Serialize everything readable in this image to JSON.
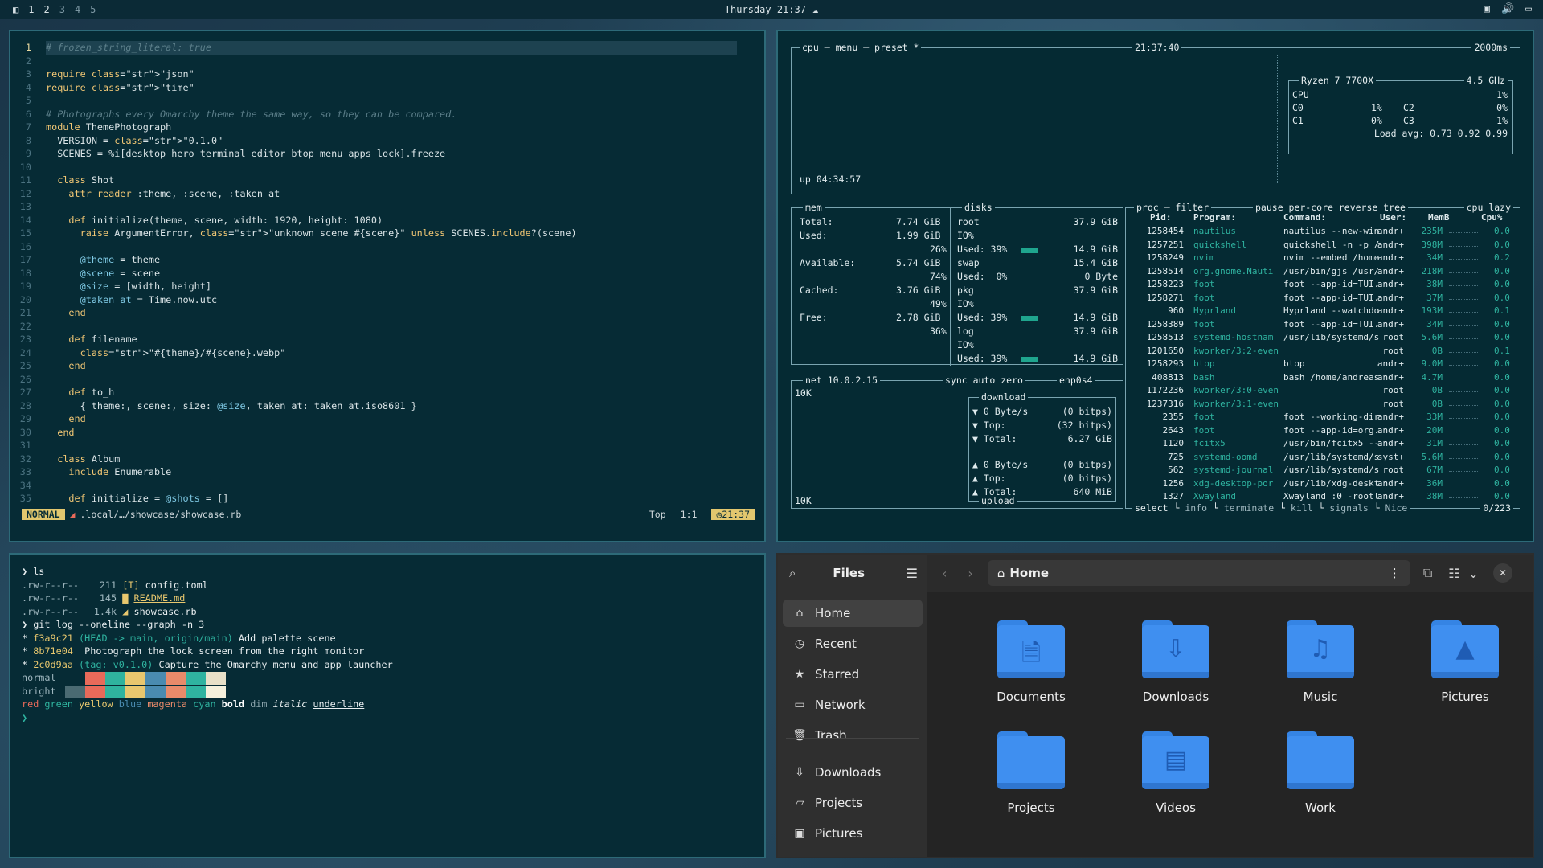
{
  "topbar": {
    "workspaces": [
      "1",
      "2",
      "3",
      "4",
      "5"
    ],
    "active": "1",
    "clock": "Thursday 21:37"
  },
  "nvim": {
    "lines": [
      {
        "n": "1",
        "t": "# frozen_string_literal: true"
      },
      {
        "n": "2",
        "t": ""
      },
      {
        "n": "3",
        "t": "require \"json\""
      },
      {
        "n": "4",
        "t": "require \"time\""
      },
      {
        "n": "5",
        "t": ""
      },
      {
        "n": "6",
        "t": "# Photographs every Omarchy theme the same way, so they can be compared."
      },
      {
        "n": "7",
        "t": "module ThemePhotograph"
      },
      {
        "n": "8",
        "t": "  VERSION = \"0.1.0\""
      },
      {
        "n": "9",
        "t": "  SCENES = %i[desktop hero terminal editor btop menu apps lock].freeze"
      },
      {
        "n": "10",
        "t": ""
      },
      {
        "n": "11",
        "t": "  class Shot"
      },
      {
        "n": "12",
        "t": "    attr_reader :theme, :scene, :taken_at"
      },
      {
        "n": "13",
        "t": ""
      },
      {
        "n": "14",
        "t": "    def initialize(theme, scene, width: 1920, height: 1080)"
      },
      {
        "n": "15",
        "t": "      raise ArgumentError, \"unknown scene #{scene}\" unless SCENES.include?(scene)"
      },
      {
        "n": "16",
        "t": ""
      },
      {
        "n": "17",
        "t": "      @theme = theme"
      },
      {
        "n": "18",
        "t": "      @scene = scene"
      },
      {
        "n": "19",
        "t": "      @size = [width, height]"
      },
      {
        "n": "20",
        "t": "      @taken_at = Time.now.utc"
      },
      {
        "n": "21",
        "t": "    end"
      },
      {
        "n": "22",
        "t": ""
      },
      {
        "n": "23",
        "t": "    def filename"
      },
      {
        "n": "24",
        "t": "      \"#{theme}/#{scene}.webp\""
      },
      {
        "n": "25",
        "t": "    end"
      },
      {
        "n": "26",
        "t": ""
      },
      {
        "n": "27",
        "t": "    def to_h"
      },
      {
        "n": "28",
        "t": "      { theme:, scene:, size: @size, taken_at: taken_at.iso8601 }"
      },
      {
        "n": "29",
        "t": "    end"
      },
      {
        "n": "30",
        "t": "  end"
      },
      {
        "n": "31",
        "t": ""
      },
      {
        "n": "32",
        "t": "  class Album"
      },
      {
        "n": "33",
        "t": "    include Enumerable"
      },
      {
        "n": "34",
        "t": ""
      },
      {
        "n": "35",
        "t": "    def initialize = @shots = []"
      }
    ],
    "status": {
      "mode": "NORMAL",
      "path": ".local/…/showcase/showcase.rb",
      "pos": "Top",
      "cursor": "1:1",
      "time": "21:37"
    }
  },
  "btop": {
    "tabs": {
      "cpu": "cpu",
      "menu": "menu",
      "preset": "preset *",
      "time": "21:37:40",
      "interval": "2000ms"
    },
    "cpu": {
      "model": "Ryzen 7 7700X",
      "freq": "4.5 GHz",
      "label": "CPU",
      "total": "1%",
      "cores": [
        {
          "n": "C0",
          "v": "1%"
        },
        {
          "n": "C1",
          "v": "0%"
        },
        {
          "n": "C2",
          "v": "0%"
        },
        {
          "n": "C3",
          "v": "1%"
        }
      ],
      "load": "Load avg: 0.73 0.92 0.99",
      "uptime": "up 04:34:57"
    },
    "mem": {
      "title": "mem",
      "total": "7.74 GiB",
      "used": "1.99 GiB",
      "used_pct": "26%",
      "available": "5.74 GiB",
      "available_pct": "74%",
      "cached": "3.76 GiB",
      "cached_pct": "49%",
      "free": "2.78 GiB",
      "free_pct": "36%"
    },
    "disks": {
      "title": "disks",
      "items": [
        {
          "name": "root",
          "size": "37.9 GiB",
          "io": "IO%",
          "used": "Used: 39%",
          "used_val": "14.9 GiB"
        },
        {
          "name": "swap",
          "size": "15.4 GiB",
          "used": "Used:  0%",
          "used_val": "0 Byte"
        },
        {
          "name": "pkg",
          "size": "37.9 GiB",
          "io": "IO%",
          "used": "Used: 39%",
          "used_val": "14.9 GiB"
        },
        {
          "name": "log",
          "size": "37.9 GiB",
          "io": "IO%",
          "used": "Used: 39%",
          "used_val": "14.9 GiB"
        }
      ]
    },
    "net": {
      "title": "net",
      "ip": "10.0.2.15",
      "opts": "sync auto zero",
      "iface": "enp0s4",
      "scale_top": "10K",
      "scale_bottom": "10K",
      "download": "download",
      "dl_rate": "0 Byte/s",
      "dl_bits": "(0 bitps)",
      "dl_top": "Top:",
      "dl_top_bits": "(32 bitps)",
      "dl_total": "Total:",
      "dl_total_val": "6.27 GiB",
      "ul_rate": "0 Byte/s",
      "ul_bits": "(0 bitps)",
      "ul_top": "Top:",
      "ul_top_bits": "(0 bitps)",
      "ul_total": "Total:",
      "ul_total_val": "640 MiB",
      "upload": "upload"
    },
    "proc": {
      "title": "proc",
      "filter": "filter",
      "opts": "pause per-core reverse tree",
      "sort": "cpu lazy",
      "header": {
        "pid": "Pid:",
        "program": "Program:",
        "command": "Command:",
        "user": "User:",
        "mem": "MemB",
        "cpu": "Cpu%"
      },
      "rows": [
        [
          "1258454",
          "nautilus",
          "nautilus --new-win",
          "andr+",
          "235M",
          "0.0"
        ],
        [
          "1257251",
          "quickshell",
          "quickshell -n -p /",
          "andr+",
          "398M",
          "0.0"
        ],
        [
          "1258249",
          "nvim",
          "nvim --embed /home",
          "andr+",
          "34M",
          "0.2"
        ],
        [
          "1258514",
          "org.gnome.Nauti",
          "/usr/bin/gjs /usr/",
          "andr+",
          "218M",
          "0.0"
        ],
        [
          "1258223",
          "foot",
          "foot --app-id=TUI.",
          "andr+",
          "38M",
          "0.0"
        ],
        [
          "1258271",
          "foot",
          "foot --app-id=TUI.",
          "andr+",
          "37M",
          "0.0"
        ],
        [
          "960",
          "Hyprland",
          "Hyprland --watchdo",
          "andr+",
          "193M",
          "0.1"
        ],
        [
          "1258389",
          "foot",
          "foot --app-id=TUI.",
          "andr+",
          "34M",
          "0.0"
        ],
        [
          "1258513",
          "systemd-hostnam",
          "/usr/lib/systemd/s",
          "root",
          "5.6M",
          "0.0"
        ],
        [
          "1201650",
          "kworker/3:2-even",
          "",
          "root",
          "0B",
          "0.1"
        ],
        [
          "1258293",
          "btop",
          "btop",
          "andr+",
          "9.0M",
          "0.0"
        ],
        [
          "408813",
          "bash",
          "bash /home/andreas",
          "andr+",
          "4.7M",
          "0.0"
        ],
        [
          "1172236",
          "kworker/3:0-even",
          "",
          "root",
          "0B",
          "0.0"
        ],
        [
          "1237316",
          "kworker/3:1-even",
          "",
          "root",
          "0B",
          "0.0"
        ],
        [
          "2355",
          "foot",
          "foot --working-dir",
          "andr+",
          "33M",
          "0.0"
        ],
        [
          "2643",
          "foot",
          "foot --app-id=org.",
          "andr+",
          "20M",
          "0.0"
        ],
        [
          "1120",
          "fcitx5",
          "/usr/bin/fcitx5 --",
          "andr+",
          "31M",
          "0.0"
        ],
        [
          "725",
          "systemd-oomd",
          "/usr/lib/systemd/s",
          "syst+",
          "5.6M",
          "0.0"
        ],
        [
          "562",
          "systemd-journal",
          "/usr/lib/systemd/s",
          "root",
          "67M",
          "0.0"
        ],
        [
          "1256",
          "xdg-desktop-por",
          "/usr/lib/xdg-deskt",
          "andr+",
          "36M",
          "0.0"
        ],
        [
          "1327",
          "Xwayland",
          "Xwayland :0 -rootl",
          "andr+",
          "38M",
          "0.0"
        ]
      ],
      "footer": {
        "select": "select",
        "info": "info",
        "terminate": "terminate",
        "kill": "kill",
        "signals": "signals",
        "nice": "Nice",
        "count": "0/223"
      }
    }
  },
  "terminal": {
    "lines": [
      {
        "k": "prompt",
        "t": "❯ ls"
      },
      {
        "k": "ls",
        "perm": ".rw-r--r--",
        "size": "211",
        "icon": "[T]",
        "name": "config.toml"
      },
      {
        "k": "ls",
        "perm": ".rw-r--r--",
        "size": "145",
        "icon": "▇",
        "name": "README.md"
      },
      {
        "k": "ls",
        "perm": ".rw-r--r--",
        "size": "1.4k",
        "icon": "◢",
        "name": "showcase.rb"
      },
      {
        "k": "prompt",
        "t": "❯ git log --oneline --graph -n 3"
      },
      {
        "k": "git",
        "hash": "f3a9c21",
        "ref": "(HEAD -> main, origin/main)",
        "msg": "Add palette scene"
      },
      {
        "k": "git",
        "hash": "8b71e04",
        "ref": "",
        "msg": "Photograph the lock screen from the right monitor"
      },
      {
        "k": "git",
        "hash": "2c0d9aa",
        "ref": "(tag: v0.1.0)",
        "msg": "Capture the Omarchy menu and app launcher"
      }
    ],
    "normal_label": "normal",
    "bright_label": "bright",
    "normal_colors": [
      "#062b35",
      "#e86a5a",
      "#2fb39e",
      "#e8c76e",
      "#4a8bb0",
      "#e88a6a",
      "#2fb3a0",
      "#e8e0c8"
    ],
    "bright_colors": [
      "#4a6a72",
      "#e86a5a",
      "#2fb39e",
      "#e8c76e",
      "#4a8bb0",
      "#e88a6a",
      "#2fb3a0",
      "#f5f0dc"
    ],
    "styles": {
      "red": "red",
      "green": "green",
      "yellow": "yellow",
      "blue": "blue",
      "magenta": "magenta",
      "cyan": "cyan",
      "bold": "bold",
      "dim": "dim",
      "italic": "italic",
      "underline": "underline"
    },
    "final_prompt": "❯"
  },
  "files": {
    "title": "Files",
    "location": "Home",
    "sidebar": [
      {
        "label": "Home",
        "icon": "home-icon",
        "glyph": "⌂"
      },
      {
        "label": "Recent",
        "icon": "clock-icon",
        "glyph": "◷"
      },
      {
        "label": "Starred",
        "icon": "star-icon",
        "glyph": "★"
      },
      {
        "label": "Network",
        "icon": "network-icon",
        "glyph": "▭"
      },
      {
        "label": "Trash",
        "icon": "trash-icon",
        "glyph": "🗑"
      },
      {
        "label": "Downloads",
        "icon": "download-icon",
        "glyph": "⇩"
      },
      {
        "label": "Projects",
        "icon": "folder-icon",
        "glyph": "▱"
      },
      {
        "label": "Pictures",
        "icon": "image-icon",
        "glyph": "▣"
      }
    ],
    "folders": [
      {
        "label": "Documents",
        "icon": "documents-folder-icon",
        "glyph": "🗎"
      },
      {
        "label": "Downloads",
        "icon": "downloads-folder-icon",
        "glyph": "⇩"
      },
      {
        "label": "Music",
        "icon": "music-folder-icon",
        "glyph": "♫"
      },
      {
        "label": "Pictures",
        "icon": "pictures-folder-icon",
        "glyph": "▲"
      },
      {
        "label": "Projects",
        "icon": "projects-folder-icon",
        "glyph": ""
      },
      {
        "label": "Videos",
        "icon": "videos-folder-icon",
        "glyph": "▤"
      },
      {
        "label": "Work",
        "icon": "work-folder-icon",
        "glyph": ""
      }
    ]
  }
}
